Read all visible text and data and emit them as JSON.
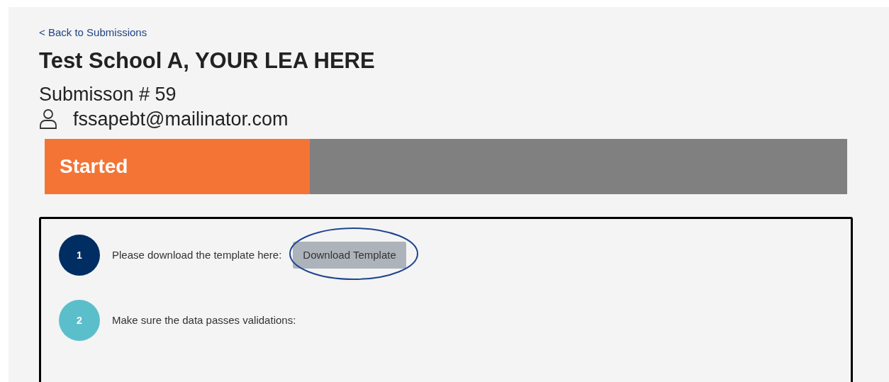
{
  "back_link": "< Back to Submissions",
  "title": "Test School A, YOUR LEA HERE",
  "submission": "Submisson # 59",
  "email": "fssapebt@mailinator.com",
  "progress": {
    "label": "Started",
    "level": 0.33
  },
  "steps": [
    {
      "number": "1",
      "color": "#002d62",
      "text": "Please download the template here:",
      "button": "Download Template",
      "highlighted": true
    },
    {
      "number": "2",
      "color": "#5bbfcb",
      "text": "Make sure the data passes validations:"
    }
  ]
}
